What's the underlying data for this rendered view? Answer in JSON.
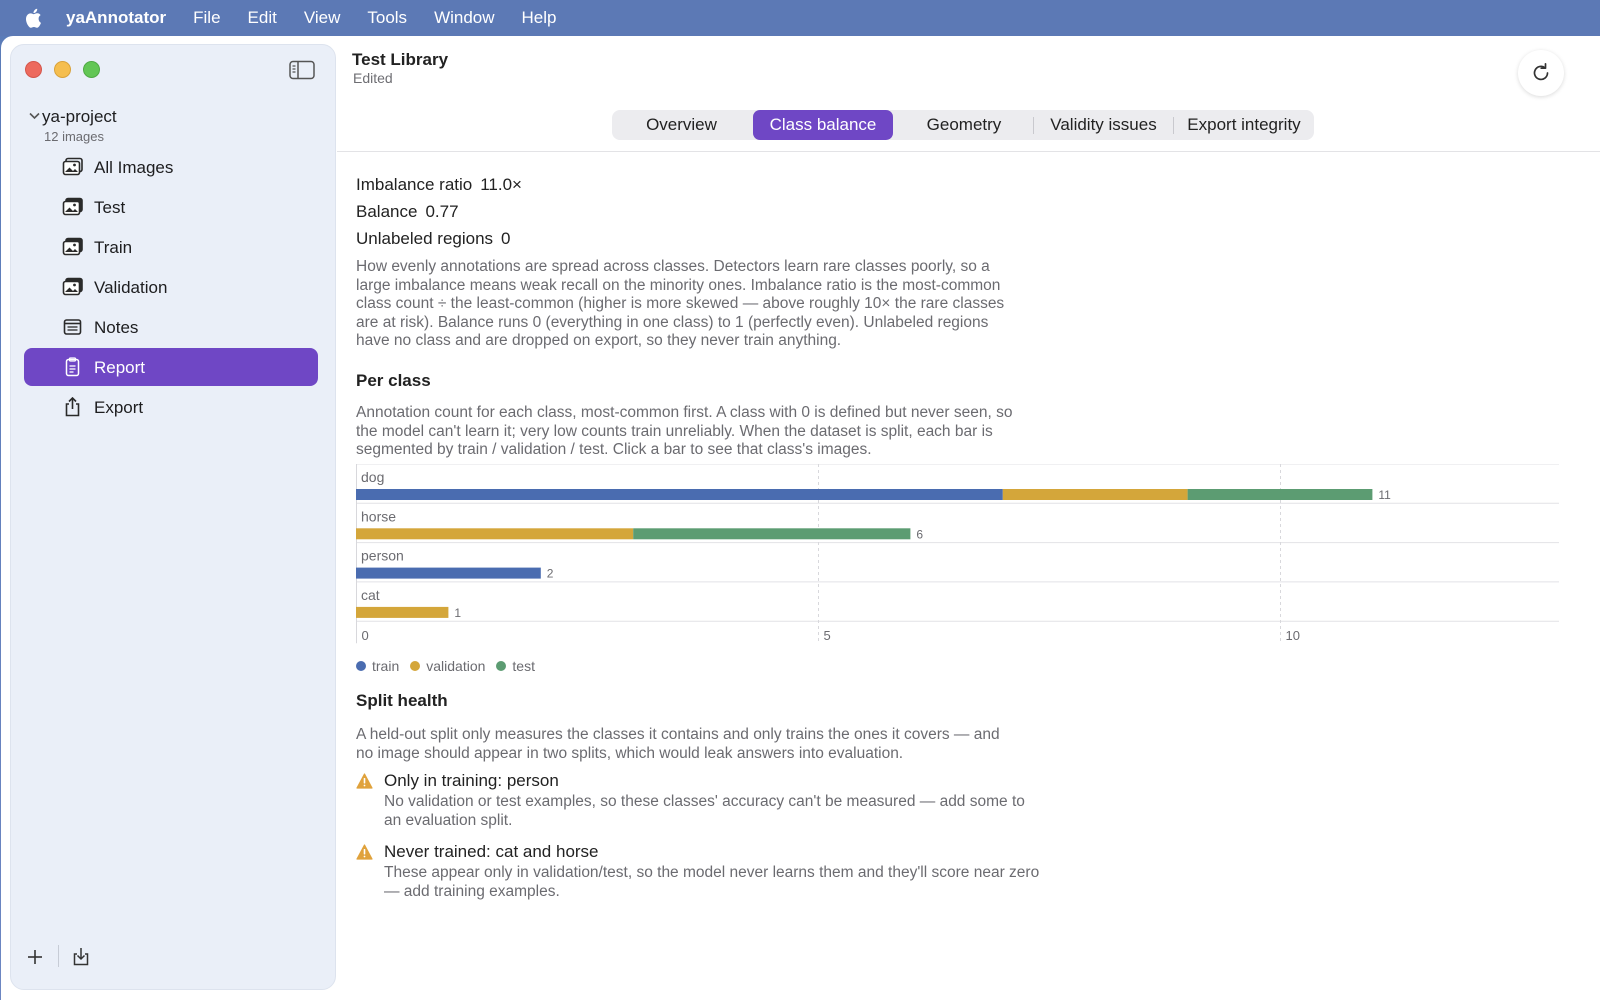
{
  "menubar": {
    "app": "yaAnnotator",
    "items": [
      "File",
      "Edit",
      "View",
      "Tools",
      "Window",
      "Help"
    ]
  },
  "sidebar": {
    "project": {
      "name": "ya-project",
      "count": "12 images"
    },
    "items": [
      {
        "label": "All Images",
        "icon": "photo-stack-icon"
      },
      {
        "label": "Test",
        "icon": "photo-stack-icon"
      },
      {
        "label": "Train",
        "icon": "photo-stack-icon"
      },
      {
        "label": "Validation",
        "icon": "photo-stack-icon"
      },
      {
        "label": "Notes",
        "icon": "notes-icon"
      },
      {
        "label": "Report",
        "icon": "clipboard-icon",
        "active": true
      },
      {
        "label": "Export",
        "icon": "share-icon"
      }
    ]
  },
  "header": {
    "title": "Test Library",
    "subtitle": "Edited"
  },
  "tabs": [
    {
      "label": "Overview"
    },
    {
      "label": "Class balance",
      "active": true
    },
    {
      "label": "Geometry"
    },
    {
      "label": "Validity issues"
    },
    {
      "label": "Export integrity"
    }
  ],
  "stats": [
    {
      "label": "Imbalance ratio",
      "value": "11.0×"
    },
    {
      "label": "Balance",
      "value": "0.77"
    },
    {
      "label": "Unlabeled regions",
      "value": "0"
    }
  ],
  "intro": "How evenly annotations are spread across classes. Detectors learn rare classes poorly, so a large imbalance means weak recall on the minority ones. Imbalance ratio is the most-common class count ÷ the least-common (higher is more skewed — above roughly 10× the rare classes are at risk). Balance runs 0 (everything in one class) to 1 (perfectly even). Unlabeled regions have no class and are dropped on export, so they never train anything.",
  "per_class": {
    "heading": "Per class",
    "description": "Annotation count for each class, most-common first. A class with 0 is defined but never seen, so the model can't learn it; very low counts train unreliably. When the dataset is split, each bar is segmented by train / validation / test. Click a bar to see that class's images."
  },
  "colors": {
    "train": "#4a6cb0",
    "validation": "#d4a63a",
    "test": "#5c9c72",
    "accent": "#6f47c5",
    "warning": "#e0a23c"
  },
  "chart_data": {
    "type": "bar",
    "orientation": "horizontal",
    "stacked": true,
    "categories": [
      "dog",
      "horse",
      "person",
      "cat"
    ],
    "series": [
      {
        "name": "train",
        "values": [
          7,
          0,
          2,
          0
        ]
      },
      {
        "name": "validation",
        "values": [
          2,
          3,
          0,
          1
        ]
      },
      {
        "name": "test",
        "values": [
          2,
          3,
          0,
          0
        ]
      }
    ],
    "totals": [
      11,
      6,
      2,
      1
    ],
    "xlim": [
      0,
      13
    ],
    "xticks": [
      0,
      5,
      10
    ],
    "grid": true,
    "legend": "bottom-left"
  },
  "split_health": {
    "heading": "Split health",
    "description": "A held-out split only measures the classes it contains and only trains the ones it covers — and no image should appear in two splits, which would leak answers into evaluation.",
    "warnings": [
      {
        "title": "Only in training: person",
        "detail": "No validation or test examples, so these classes' accuracy can't be measured — add some to an evaluation split."
      },
      {
        "title": "Never trained: cat and horse",
        "detail": "These appear only in validation/test, so the model never learns them and they'll score near zero — add training examples."
      }
    ]
  }
}
